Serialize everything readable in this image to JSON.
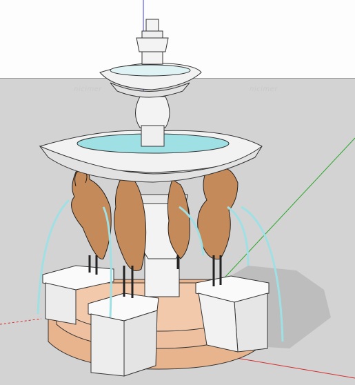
{
  "viewport": {
    "sky_color": "#fdfdfd",
    "ground_color": "#d3d3d3",
    "axis_colors": {
      "red": "#d42b2b",
      "green": "#2aa52a",
      "blue": "#3a3ae0"
    }
  },
  "watermarks": [
    "nicimer",
    "nicimer"
  ],
  "model": {
    "stone_color": "#f1f1f1",
    "water_color": "#9fe0e4",
    "crane_color": "#c48a5a",
    "step_color": "#e8b48d",
    "shadow_color": "#bdbdbd"
  }
}
